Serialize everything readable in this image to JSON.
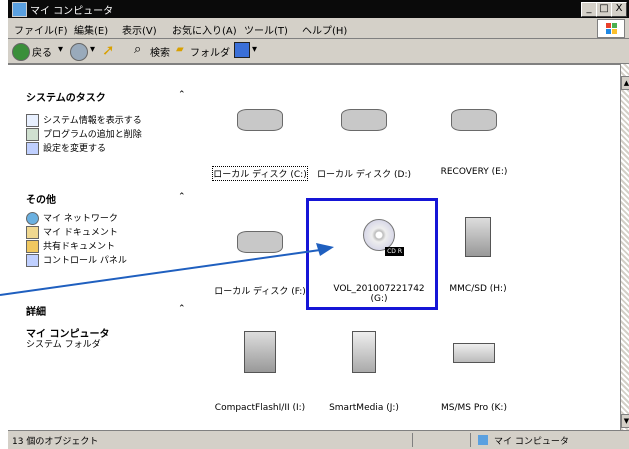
{
  "window": {
    "title": "マイ コンピュータ",
    "controls": [
      "_",
      "□",
      "X"
    ]
  },
  "menu": [
    "ファイル(F)",
    "編集(E)",
    "表示(V)",
    "お気に入り(A)",
    "ツール(T)",
    "ヘルプ(H)"
  ],
  "toolbar": {
    "back": "戻る",
    "search": "検索",
    "folders": "フォルダ"
  },
  "left_pane": {
    "system_tasks": {
      "header": "システムのタスク",
      "items": [
        "システム情報を表示する",
        "プログラムの追加と削除",
        "設定を変更する"
      ]
    },
    "other": {
      "header": "その他",
      "items": [
        "マイ ネットワーク",
        "マイ ドキュメント",
        "共有ドキュメント",
        "コントロール パネル"
      ]
    },
    "details": {
      "header": "詳細",
      "title": "マイ コンピュータ",
      "subtitle": "システム フォルダ"
    }
  },
  "drives": [
    {
      "label": "ローカル ディスク (C:)",
      "icon": "hdd-icon"
    },
    {
      "label": "ローカル ディスク (D:)",
      "icon": "hdd-icon"
    },
    {
      "label": "RECOVERY (E:)",
      "icon": "hdd-icon"
    },
    {
      "label": "ローカル ディスク (F:)",
      "icon": "hdd-icon"
    },
    {
      "label": "VOL_201007221742 (G:)",
      "icon": "cd-r-icon",
      "badge": "CD R"
    },
    {
      "label": "MMC/SD (H:)",
      "icon": "mmc-sd-icon"
    },
    {
      "label": "CompactFlashI/II (I:)",
      "icon": "compactflash-icon"
    },
    {
      "label": "SmartMedia (J:)",
      "icon": "smartmedia-icon"
    },
    {
      "label": "MS/MS Pro (K:)",
      "icon": "memorystick-icon"
    }
  ],
  "status": {
    "objects": "13 個のオブジェクト",
    "location": "マイ コンピュータ"
  },
  "colors": {
    "highlight": "#1515d6",
    "titlebar": "#0a0a0a",
    "arrow": "#1f5fbf"
  }
}
